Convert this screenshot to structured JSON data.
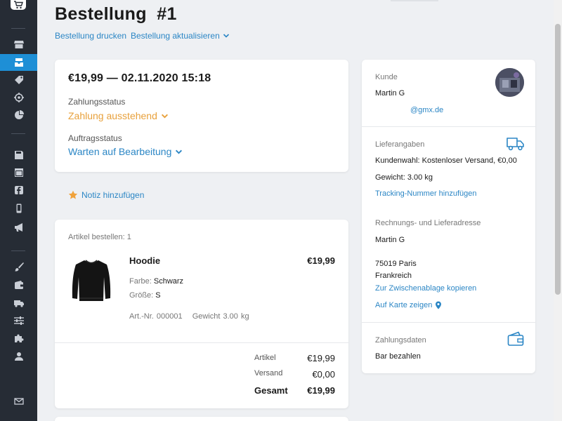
{
  "header": {
    "title": "Bestellung  #1",
    "print_label": "Bestellung drucken",
    "update_label": "Bestellung aktualisieren"
  },
  "sidebar": {
    "items": [
      {
        "icon": "store-icon"
      },
      {
        "icon": "orders-icon",
        "active": true
      },
      {
        "icon": "tag-icon"
      },
      {
        "icon": "target-icon"
      },
      {
        "icon": "pie-chart-icon"
      },
      {
        "icon": "save-icon"
      },
      {
        "icon": "browser-icon"
      },
      {
        "icon": "facebook-icon"
      },
      {
        "icon": "mobile-icon"
      },
      {
        "icon": "megaphone-icon"
      },
      {
        "icon": "brush-icon"
      },
      {
        "icon": "wallet-icon"
      },
      {
        "icon": "truck-icon"
      },
      {
        "icon": "sliders-icon"
      },
      {
        "icon": "puzzle-icon"
      },
      {
        "icon": "user-icon"
      },
      {
        "icon": "mail-icon"
      }
    ]
  },
  "order": {
    "amount_date": "€19,99 — 02.11.2020 15:18",
    "payment_status_label": "Zahlungsstatus",
    "payment_status": "Zahlung ausstehend",
    "order_status_label": "Auftragsstatus",
    "order_status": "Warten auf Bearbeitung"
  },
  "note": {
    "label": "Notiz hinzufügen"
  },
  "items": {
    "count_label": "Artikel bestellen: 1",
    "product": {
      "name": "Hoodie",
      "price": "€19,99",
      "color_label": "Farbe:",
      "color": "Schwarz",
      "size_label": "Größe:",
      "size": "S",
      "sku_label": "Art.-Nr.",
      "sku": "000001",
      "weight_label": "Gewicht",
      "weight": "3.00 kg"
    },
    "totals": {
      "articles_label": "Artikel",
      "articles": "€19,99",
      "shipping_label": "Versand",
      "shipping": "€0,00",
      "total_label": "Gesamt",
      "total": "€19,99"
    }
  },
  "customer": {
    "heading": "Kunde",
    "name": "Martin G",
    "email": "@gmx.de"
  },
  "shipping": {
    "heading": "Lieferangaben",
    "choice": "Kundenwahl: Kostenloser Versand, €0,00",
    "weight": "Gewicht: 3.00 kg",
    "tracking_link": "Tracking-Nummer hinzufügen"
  },
  "address": {
    "heading": "Rechnungs- und Lieferadresse",
    "name": "Martin G",
    "city": "75019 Paris",
    "country": "Frankreich",
    "copy_link": "Zur Zwischenablage kopieren",
    "map_link": "Auf Karte zeigen"
  },
  "payment": {
    "heading": "Zahlungsdaten",
    "method": "Bar bezahlen"
  },
  "colors": {
    "accent": "#1e8fd6",
    "link": "#2b86c5",
    "pending": "#e8a13c",
    "sidebar": "#262c35"
  }
}
